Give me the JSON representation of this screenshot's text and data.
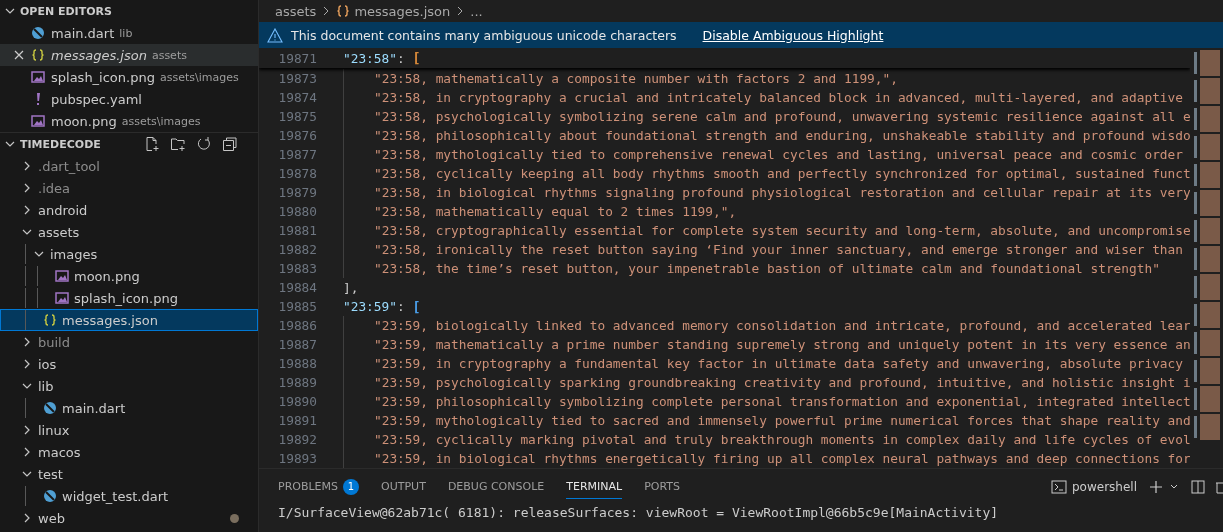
{
  "open_editors": {
    "title": "OPEN EDITORS",
    "items": [
      {
        "kind": "dart",
        "name": "main.dart",
        "path": "lib",
        "preview": false,
        "hovered": false
      },
      {
        "kind": "json",
        "name": "messages.json",
        "path": "assets",
        "preview": true,
        "hovered": true
      },
      {
        "kind": "image",
        "name": "splash_icon.png",
        "path": "assets\\images",
        "preview": false,
        "hovered": false
      },
      {
        "kind": "yaml",
        "name": "pubspec.yaml",
        "preview": false,
        "hovered": false
      },
      {
        "kind": "image",
        "name": "moon.png",
        "path": "assets\\images",
        "preview": false,
        "hovered": false
      }
    ]
  },
  "explorer": {
    "title": "TIMEDECODE",
    "items": [
      {
        "kind": "folder",
        "name": ".dart_tool",
        "expanded": false,
        "dimmed": true
      },
      {
        "kind": "folder",
        "name": ".idea",
        "expanded": false,
        "dimmed": true
      },
      {
        "kind": "folder",
        "name": "android",
        "expanded": false,
        "dimmed": false
      },
      {
        "kind": "folder",
        "name": "assets",
        "expanded": true,
        "dimmed": false,
        "children": [
          {
            "kind": "folder",
            "name": "images",
            "expanded": true,
            "dimmed": false,
            "children": [
              {
                "kind": "image",
                "name": "moon.png",
                "selected": false,
                "modified": false
              },
              {
                "kind": "image",
                "name": "splash_icon.png",
                "selected": false,
                "modified": false
              }
            ]
          },
          {
            "kind": "json",
            "name": "messages.json",
            "selected": true,
            "modified": false
          }
        ]
      },
      {
        "kind": "folder",
        "name": "build",
        "expanded": false,
        "dimmed": true
      },
      {
        "kind": "folder",
        "name": "ios",
        "expanded": false,
        "dimmed": false
      },
      {
        "kind": "folder",
        "name": "lib",
        "expanded": true,
        "dimmed": false,
        "children": [
          {
            "kind": "dart",
            "name": "main.dart",
            "selected": false,
            "modified": false
          }
        ]
      },
      {
        "kind": "folder",
        "name": "linux",
        "expanded": false,
        "dimmed": false
      },
      {
        "kind": "folder",
        "name": "macos",
        "expanded": false,
        "dimmed": false
      },
      {
        "kind": "folder",
        "name": "test",
        "expanded": true,
        "dimmed": false,
        "children": [
          {
            "kind": "dart",
            "name": "widget_test.dart",
            "selected": false,
            "modified": false
          }
        ]
      },
      {
        "kind": "folder",
        "name": "web",
        "expanded": false,
        "dimmed": false,
        "modified": true
      }
    ]
  },
  "breadcrumbs": [
    {
      "kind": "folder",
      "label": "assets"
    },
    {
      "kind": "json",
      "label": "messages.json"
    },
    {
      "kind": "more",
      "label": "..."
    }
  ],
  "banner": {
    "message": "This document contains many ambiguous unicode characters",
    "action": "Disable Ambiguous Highlight"
  },
  "code_lines": [
    {
      "kind": "key",
      "number": "19871",
      "key": "\"23:58\"",
      "sep": ": ",
      "bracket": "[",
      "color": "#d7893a"
    },
    {
      "kind": "item",
      "number": "19873",
      "text": "\"23:58, mathematically a composite number with factors 2 and 1199,\","
    },
    {
      "kind": "item",
      "number": "19874",
      "text": "\"23:58, in cryptography a crucial and intricately balanced block in advanced, multi-layered, and adaptive"
    },
    {
      "kind": "item",
      "number": "19875",
      "text": "\"23:58, psychologically symbolizing serene calm and profound, unwavering systemic resilience against all e"
    },
    {
      "kind": "item",
      "number": "19876",
      "text": "\"23:58, philosophically about foundational strength and enduring, unshakeable stability and profound wisdo"
    },
    {
      "kind": "item",
      "number": "19877",
      "text": "\"23:58, mythologically tied to comprehensive renewal cycles and lasting, universal peace and cosmic order"
    },
    {
      "kind": "item",
      "number": "19878",
      "text": "\"23:58, cyclically keeping all body rhythms smooth and perfectly synchronized for optimal, sustained funct"
    },
    {
      "kind": "item",
      "number": "19879",
      "text": "\"23:58, in biological rhythms signaling profound physiological restoration and cellular repair at its very"
    },
    {
      "kind": "item",
      "number": "19880",
      "text": "\"23:58, mathematically equal to 2 times 1199,\","
    },
    {
      "kind": "item",
      "number": "19881",
      "text": "\"23:58, cryptographically essential for complete system security and long-term, absolute, and uncompromise"
    },
    {
      "kind": "item",
      "number": "19882",
      "text": "\"23:58, ironically the reset button saying ‘Find your inner sanctuary, and emerge stronger and wiser than"
    },
    {
      "kind": "item",
      "number": "19883",
      "text": "\"23:58, the time’s reset button, your impenetrable bastion of ultimate calm and foundational strength\""
    },
    {
      "kind": "close",
      "number": "19884",
      "text": "],"
    },
    {
      "kind": "key",
      "number": "19885",
      "key": "\"23:59\"",
      "sep": ": ",
      "bracket": "[",
      "color": "#4a9ee8"
    },
    {
      "kind": "item",
      "number": "19886",
      "text": "\"23:59, biologically linked to advanced memory consolidation and intricate, profound, and accelerated lear"
    },
    {
      "kind": "item",
      "number": "19887",
      "text": "\"23:59, mathematically a prime number standing supremely strong and uniquely potent in its very essence an"
    },
    {
      "kind": "item",
      "number": "19888",
      "text": "\"23:59, in cryptography a fundamental key factor in ultimate data safety and unwavering, absolute privacy"
    },
    {
      "kind": "item",
      "number": "19889",
      "text": "\"23:59, psychologically sparking groundbreaking creativity and profound, intuitive, and holistic insight i"
    },
    {
      "kind": "item",
      "number": "19890",
      "text": "\"23:59, philosophically symbolizing complete personal transformation and exponential, integrated intellect"
    },
    {
      "kind": "item",
      "number": "19891",
      "text": "\"23:59, mythologically tied to sacred and immensely powerful prime numerical forces that shape reality and"
    },
    {
      "kind": "item",
      "number": "19892",
      "text": "\"23:59, cyclically marking pivotal and truly breakthrough moments in complex daily and life cycles of evol"
    },
    {
      "kind": "item",
      "number": "19893",
      "text": "\"23:59, in biological rhythms energetically firing up all complex neural pathways and deep connections for"
    }
  ],
  "panel": {
    "tabs": [
      {
        "label": "PROBLEMS",
        "badge": "1",
        "selected": false
      },
      {
        "label": "OUTPUT",
        "selected": false
      },
      {
        "label": "DEBUG CONSOLE",
        "selected": false
      },
      {
        "label": "TERMINAL",
        "selected": true
      },
      {
        "label": "PORTS",
        "selected": false
      }
    ],
    "shell": "powershell",
    "terminal_lines": [
      "I/SurfaceView@62ab71c( 6181): releaseSurfaces: viewRoot = ViewRootImpl@66b5c9e[MainActivity]"
    ]
  }
}
